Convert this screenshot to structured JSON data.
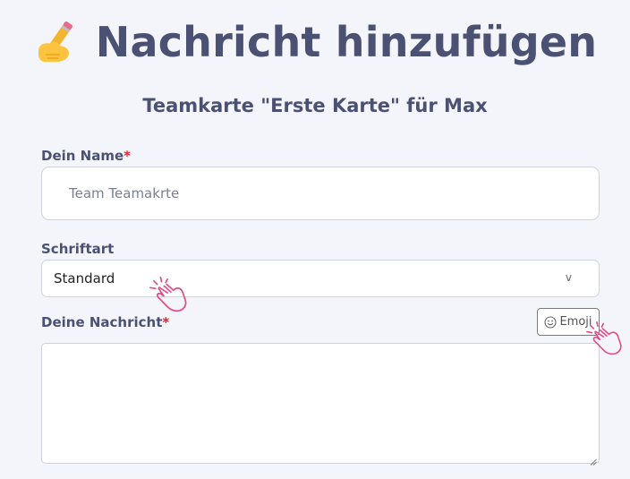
{
  "header": {
    "title_icon": "writing-hand-icon",
    "title": "Nachricht hinzufügen",
    "subtitle": "Teamkarte \"Erste Karte\" für Max"
  },
  "form": {
    "name": {
      "label": "Dein Name",
      "required_mark": "*",
      "placeholder": "Team Teamakrte"
    },
    "font": {
      "label": "Schriftart",
      "selected": "Standard",
      "chevron": "v"
    },
    "message": {
      "label": "Deine Nachricht",
      "required_mark": "*",
      "emoji_button_label": "Emoji",
      "emoji_icon": "smiley-icon"
    }
  },
  "overlays": {
    "cursor_icon": "pointing-hand-cursor-icon"
  },
  "colors": {
    "background": "#f4f5fa",
    "heading": "#4b5173",
    "required": "#e0282d",
    "cursor_pink": "#e24d8a",
    "border": "#cfd3e0"
  }
}
